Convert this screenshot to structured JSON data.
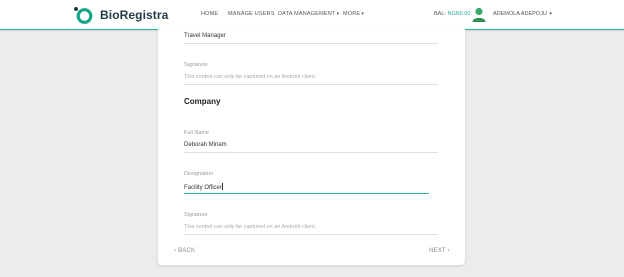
{
  "brand": {
    "name": "BioRegistra",
    "accent": "#2bb59a"
  },
  "nav": {
    "home": "HOME",
    "manage_users": "MANAGE USERS",
    "data_management": "DATA MANAGEMENT",
    "more": "MORE",
    "caret": "▾"
  },
  "account": {
    "bal_label": "BAL:",
    "bal_amount": "NGN0.00",
    "user_name": "ADEMOLA ADEPOJU",
    "caret": "▾"
  },
  "form": {
    "top_value": "Travel Manager",
    "signature1_label": "Signature",
    "signature1_hint": "This control can only be captured on an Android client",
    "company_title": "Company",
    "full_name_label": "Full Name",
    "full_name_value": "Deborah Miriam",
    "designation_label": "Designation",
    "designation_value": "Facility Officer",
    "signature2_label": "Signature",
    "signature2_hint": "This control can only be captured on an Android client"
  },
  "pager": {
    "back": "‹ BACK",
    "next": "NEXT ›"
  }
}
